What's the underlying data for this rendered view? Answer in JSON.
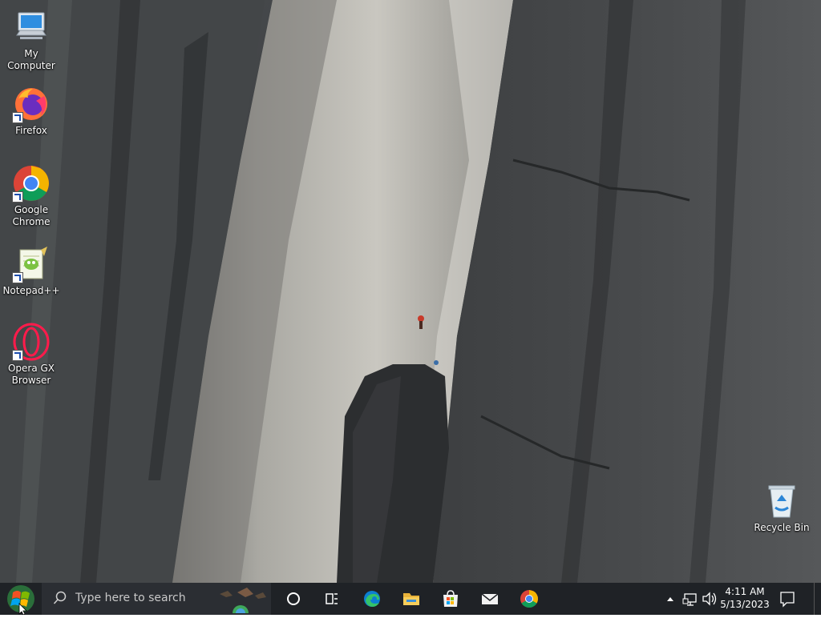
{
  "desktop": {
    "icons": [
      {
        "label": "My Computer",
        "icon": "computer-icon"
      },
      {
        "label": "Firefox",
        "icon": "firefox-icon"
      },
      {
        "label": "Google Chrome",
        "icon": "chrome-icon"
      },
      {
        "label": "Notepad++",
        "icon": "notepadpp-icon"
      },
      {
        "label": "Opera GX Browser",
        "icon": "opera-gx-icon"
      },
      {
        "label": "Recycle Bin",
        "icon": "recycle-bin-icon"
      }
    ]
  },
  "taskbar": {
    "search_placeholder": "Type here to search",
    "pinned": [
      "cortana-icon",
      "task-view-icon",
      "edge-icon",
      "file-explorer-icon",
      "microsoft-store-icon",
      "mail-icon",
      "chrome-icon"
    ],
    "clock": {
      "time": "4:11 AM",
      "date": "5/13/2023"
    }
  },
  "colors": {
    "taskbar": "#1f2226",
    "search": "#2b2e33"
  }
}
